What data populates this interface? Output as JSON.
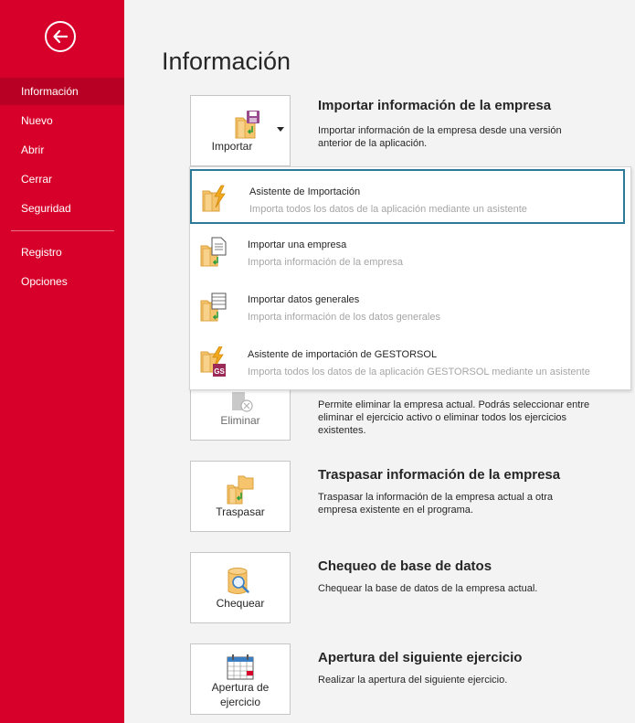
{
  "sidebar": {
    "back_label": "",
    "items": [
      {
        "label": "Información"
      },
      {
        "label": "Nuevo"
      },
      {
        "label": "Abrir"
      },
      {
        "label": "Cerrar"
      },
      {
        "label": "Seguridad"
      },
      {
        "label": "Registro"
      },
      {
        "label": "Opciones"
      }
    ],
    "active_index": 0
  },
  "page": {
    "title": "Información"
  },
  "sections": {
    "import": {
      "button_label": "Importar",
      "title": "Importar información de la empresa",
      "description": "Importar información de la empresa desde una versión anterior de la aplicación."
    },
    "delete": {
      "button_label": "Eliminar",
      "description": "Permite eliminar la empresa actual. Podrás seleccionar entre eliminar el ejercicio activo o eliminar todos los ejercicios existentes."
    },
    "transfer": {
      "button_label": "Traspasar",
      "title": "Traspasar información de la empresa",
      "description": "Traspasar la información de la empresa actual a otra empresa existente en el programa."
    },
    "check": {
      "button_label": "Chequear",
      "title": "Chequeo de base de datos",
      "description": "Chequear la base de datos de la empresa actual."
    },
    "opening": {
      "button_label_line1": "Apertura de",
      "button_label_line2": "ejercicio",
      "title": "Apertura del siguiente ejercicio",
      "description": "Realizar la apertura del siguiente ejercicio."
    }
  },
  "dropdown": {
    "items": [
      {
        "title": "Asistente de Importación",
        "description": "Importa todos los datos de la aplicación mediante un asistente",
        "icon": "lightning-folder-icon"
      },
      {
        "title": "Importar una empresa",
        "description": "Importa información de la empresa",
        "icon": "document-import-icon"
      },
      {
        "title": "Importar datos generales",
        "description": "Importa información de los datos generales",
        "icon": "table-import-icon"
      },
      {
        "title": "Asistente de importación de GESTORSOL",
        "description": "Importa todos los datos de la aplicación GESTORSOL mediante un asistente",
        "icon": "gestorsol-import-icon",
        "badge": "GS"
      }
    ],
    "selected_index": 0
  },
  "colors": {
    "sidebar": "#d7002a",
    "sidebar_active": "#b80024",
    "selection_border": "#2c7a98",
    "folder": "#f6c46c",
    "arrow": "#2e9e3c"
  }
}
